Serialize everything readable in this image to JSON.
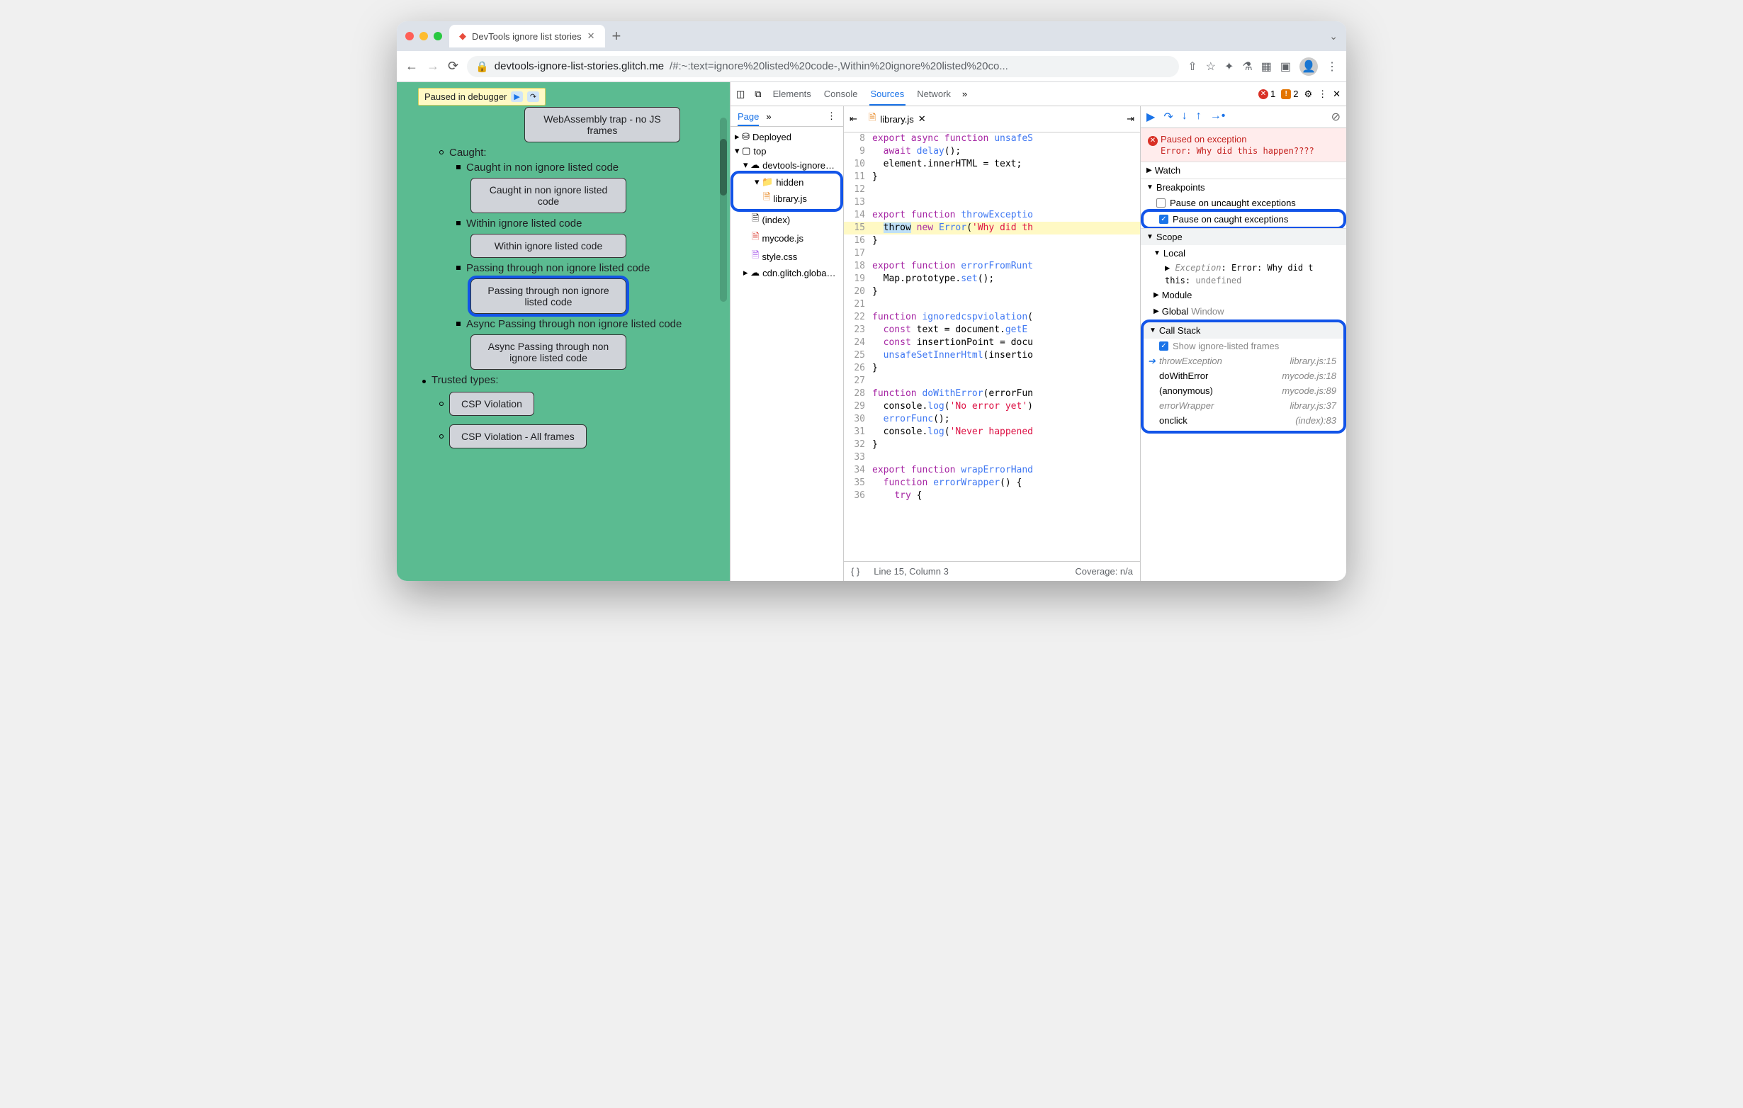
{
  "browser": {
    "tab_title": "DevTools ignore list stories",
    "url_host": "devtools-ignore-list-stories.glitch.me",
    "url_path": "/#:~:text=ignore%20listed%20code-,Within%20ignore%20listed%20co...",
    "paused_badge": "Paused in debugger"
  },
  "page_content": {
    "btn_wasm": "WebAssembly trap - no JS frames",
    "caught": "Caught:",
    "caught1_label": "Caught in non ignore listed code",
    "caught1_btn": "Caught in non ignore listed code",
    "caught2_label": "Within ignore listed code",
    "caught2_btn": "Within ignore listed code",
    "caught3_label": "Passing through non ignore listed code",
    "caught3_btn": "Passing through non ignore listed code",
    "caught4_label": "Async Passing through non ignore listed code",
    "caught4_btn": "Async Passing through non ignore listed code",
    "trusted": "Trusted types:",
    "trusted1_btn": "CSP Violation",
    "trusted2_btn": "CSP Violation - All frames"
  },
  "devtools": {
    "panels": {
      "elements": "Elements",
      "console": "Console",
      "sources": "Sources",
      "network": "Network"
    },
    "error_count": "1",
    "warn_count": "2",
    "page_tab": "Page",
    "tree": {
      "deployed": "Deployed",
      "top": "top",
      "origin": "devtools-ignore…",
      "hidden": "hidden",
      "library": "library.js",
      "index": "(index)",
      "mycode": "mycode.js",
      "style": "style.css",
      "cdn": "cdn.glitch.globa…"
    },
    "open_file": "library.js",
    "code_lines": {
      "8": "export async function unsafeS",
      "9": "  await delay();",
      "10": "  element.innerHTML = text;",
      "11": "}",
      "12": "",
      "13": "",
      "14": "export function throwExceptio",
      "15": "  throw new Error('Why did th",
      "16": "}",
      "17": "",
      "18": "export function errorFromRunt",
      "19": "  Map.prototype.set();",
      "20": "}",
      "21": "",
      "22": "function ignoredcspviolation(",
      "23": "  const text = document.getE",
      "24": "  const insertionPoint = docu",
      "25": "  unsafeSetInnerHtml(insertio",
      "26": "}",
      "27": "",
      "28": "function doWithError(errorFun",
      "29": "  console.log('No error yet')",
      "30": "  errorFunc();",
      "31": "  console.log('Never happened",
      "32": "}",
      "33": "",
      "34": "export function wrapErrorHand",
      "35": "  function errorWrapper() {",
      "36": "    try {"
    },
    "cursor_status": "Line 15, Column 3",
    "coverage_status": "Coverage: n/a",
    "debugger": {
      "paused_title": "Paused on exception",
      "paused_msg": "Error: Why did this happen????",
      "watch": "Watch",
      "breakpoints": "Breakpoints",
      "bp_uncaught": "Pause on uncaught exceptions",
      "bp_caught": "Pause on caught exceptions",
      "scope": "Scope",
      "local": "Local",
      "exception_label": "Exception",
      "exception_val": "Error: Why did t",
      "this_label": "this",
      "this_val": "undefined",
      "module": "Module",
      "global": "Global",
      "global_val": "Window",
      "callstack": "Call Stack",
      "show_ignored": "Show ignore-listed frames",
      "frames": [
        {
          "name": "throwException",
          "loc": "library.js:15",
          "ignored": true,
          "current": true
        },
        {
          "name": "doWithError",
          "loc": "mycode.js:18",
          "ignored": false
        },
        {
          "name": "(anonymous)",
          "loc": "mycode.js:89",
          "ignored": false
        },
        {
          "name": "errorWrapper",
          "loc": "library.js:37",
          "ignored": true
        },
        {
          "name": "onclick",
          "loc": "(index):83",
          "ignored": false
        }
      ]
    }
  }
}
